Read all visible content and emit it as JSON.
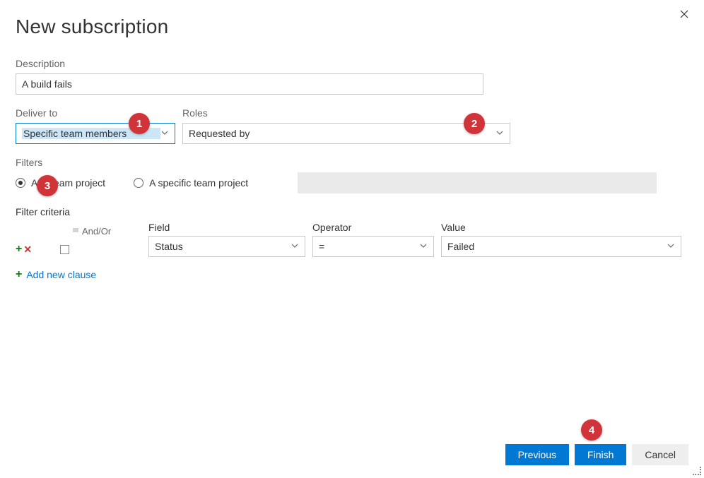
{
  "title": "New subscription",
  "description": {
    "label": "Description",
    "value": "A build fails"
  },
  "deliver_to": {
    "label": "Deliver to",
    "value": "Specific team members"
  },
  "roles": {
    "label": "Roles",
    "value": "Requested by"
  },
  "filters": {
    "label": "Filters",
    "option_any": "Any team project",
    "option_specific": "A specific team project",
    "selected": "any"
  },
  "criteria": {
    "label": "Filter criteria",
    "columns": {
      "andor": "And/Or",
      "field": "Field",
      "operator": "Operator",
      "value": "Value"
    },
    "row": {
      "field": "Status",
      "operator": "=",
      "value": "Failed"
    },
    "add_clause": "Add new clause"
  },
  "buttons": {
    "previous": "Previous",
    "finish": "Finish",
    "cancel": "Cancel"
  },
  "callouts": {
    "c1": "1",
    "c2": "2",
    "c3": "3",
    "c4": "4"
  }
}
